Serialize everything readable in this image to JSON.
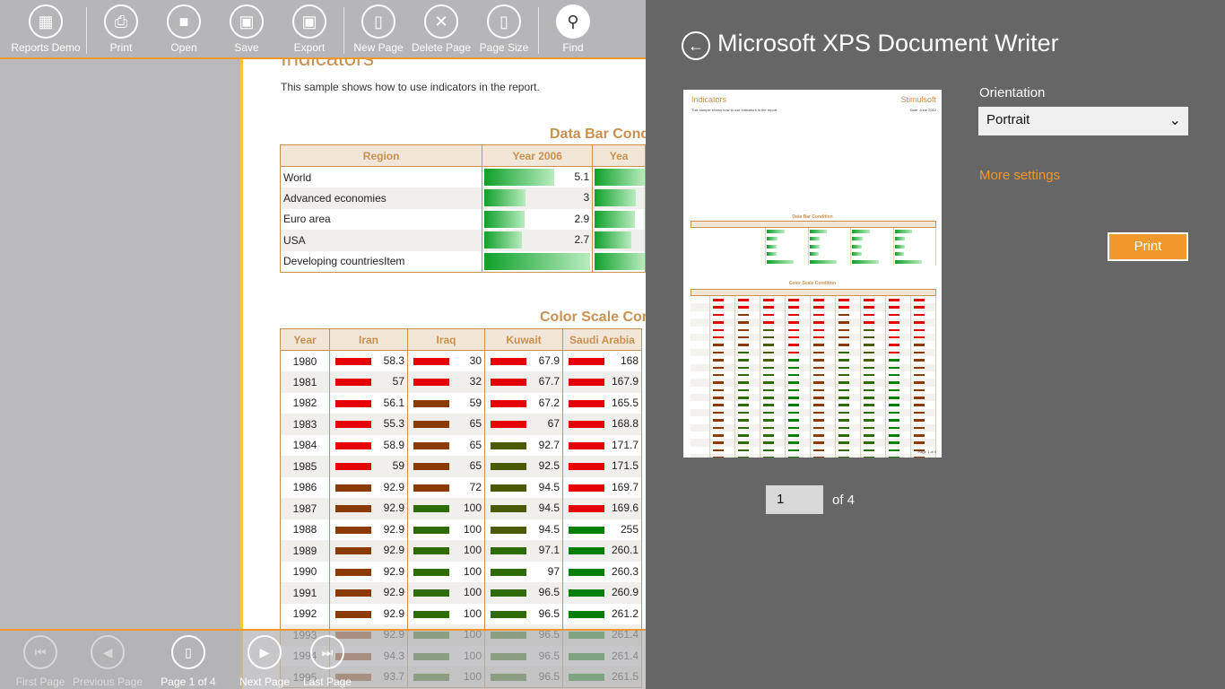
{
  "appbar": {
    "buttons": [
      {
        "label": "Reports Demo",
        "icon": "grid-icon"
      },
      {
        "label": "Print",
        "icon": "print-icon"
      },
      {
        "label": "Open",
        "icon": "folder-icon"
      },
      {
        "label": "Save",
        "icon": "save-icon"
      },
      {
        "label": "Export",
        "icon": "export-icon"
      },
      {
        "label": "New Page",
        "icon": "new-page-icon"
      },
      {
        "label": "Delete Page",
        "icon": "delete-page-icon"
      },
      {
        "label": "Page Size",
        "icon": "page-size-icon"
      },
      {
        "label": "Find",
        "icon": "search-icon"
      }
    ]
  },
  "report": {
    "title": "Indicators",
    "description": "This sample shows how to use indicators in the report.",
    "databar": {
      "title": "Data Bar Cond",
      "headers": [
        "Region",
        "Year 2006",
        "Yea"
      ],
      "rows": [
        {
          "region": "World",
          "value": "5.1",
          "fill": 0.66
        },
        {
          "region": "Advanced economies",
          "value": "3",
          "fill": 0.39
        },
        {
          "region": "Euro area",
          "value": "2.9",
          "fill": 0.38
        },
        {
          "region": "USA",
          "value": "2.7",
          "fill": 0.35
        },
        {
          "region": "Developing countriesItem",
          "value": "",
          "fill": 1.0
        }
      ]
    },
    "colorscale": {
      "title": "Color Scale Cor",
      "headers": [
        "Year",
        "Iran",
        "Iraq",
        "Kuwait",
        "Saudi Arabia"
      ],
      "rows": [
        {
          "year": "1980",
          "v": [
            "58.3",
            "30",
            "67.9",
            "168"
          ],
          "c": [
            "#e60000",
            "#e60000",
            "#e60000",
            "#e60000"
          ]
        },
        {
          "year": "1981",
          "v": [
            "57",
            "32",
            "67.7",
            "167.9"
          ],
          "c": [
            "#e60000",
            "#e60000",
            "#e60000",
            "#e60000"
          ]
        },
        {
          "year": "1982",
          "v": [
            "56.1",
            "59",
            "67.2",
            "165.5"
          ],
          "c": [
            "#e60000",
            "#8b3a00",
            "#e60000",
            "#e60000"
          ]
        },
        {
          "year": "1983",
          "v": [
            "55.3",
            "65",
            "67",
            "168.8"
          ],
          "c": [
            "#e60000",
            "#8b3a00",
            "#e60000",
            "#e60000"
          ]
        },
        {
          "year": "1984",
          "v": [
            "58.9",
            "65",
            "92.7",
            "171.7"
          ],
          "c": [
            "#e60000",
            "#8b3a00",
            "#4a5a00",
            "#e60000"
          ]
        },
        {
          "year": "1985",
          "v": [
            "59",
            "65",
            "92.5",
            "171.5"
          ],
          "c": [
            "#e60000",
            "#8b3a00",
            "#4a5a00",
            "#e60000"
          ]
        },
        {
          "year": "1986",
          "v": [
            "92.9",
            "72",
            "94.5",
            "169.7"
          ],
          "c": [
            "#8b3a00",
            "#8b3a00",
            "#4a5a00",
            "#e60000"
          ]
        },
        {
          "year": "1987",
          "v": [
            "92.9",
            "100",
            "94.5",
            "169.6"
          ],
          "c": [
            "#8b3a00",
            "#2e6b00",
            "#4a5a00",
            "#e60000"
          ]
        },
        {
          "year": "1988",
          "v": [
            "92.9",
            "100",
            "94.5",
            "255"
          ],
          "c": [
            "#8b3a00",
            "#2e6b00",
            "#4a5a00",
            "#008000"
          ]
        },
        {
          "year": "1989",
          "v": [
            "92.9",
            "100",
            "97.1",
            "260.1"
          ],
          "c": [
            "#8b3a00",
            "#2e6b00",
            "#2e6b00",
            "#008000"
          ]
        },
        {
          "year": "1990",
          "v": [
            "92.9",
            "100",
            "97",
            "260.3"
          ],
          "c": [
            "#8b3a00",
            "#2e6b00",
            "#2e6b00",
            "#008000"
          ]
        },
        {
          "year": "1991",
          "v": [
            "92.9",
            "100",
            "96.5",
            "260.9"
          ],
          "c": [
            "#8b3a00",
            "#2e6b00",
            "#2e6b00",
            "#008000"
          ]
        },
        {
          "year": "1992",
          "v": [
            "92.9",
            "100",
            "96.5",
            "261.2"
          ],
          "c": [
            "#8b3a00",
            "#2e6b00",
            "#2e6b00",
            "#008000"
          ]
        },
        {
          "year": "1993",
          "v": [
            "92.9",
            "100",
            "96.5",
            "261.4"
          ],
          "c": [
            "#8b3a00",
            "#2e6b00",
            "#2e6b00",
            "#008000"
          ]
        },
        {
          "year": "1994",
          "v": [
            "94.3",
            "100",
            "96.5",
            "261.4"
          ],
          "c": [
            "#8b3a00",
            "#2e6b00",
            "#2e6b00",
            "#008000"
          ]
        },
        {
          "year": "1995",
          "v": [
            "93.7",
            "100",
            "96.5",
            "261.5"
          ],
          "c": [
            "#8b3a00",
            "#2e6b00",
            "#2e6b00",
            "#008000"
          ]
        }
      ]
    }
  },
  "navbar": {
    "buttons": [
      {
        "label": "First Page",
        "icon": "first-page-icon",
        "enabled": false
      },
      {
        "label": "Previous Page",
        "icon": "previous-page-icon",
        "enabled": false
      },
      {
        "label": "Page 1 of 4",
        "icon": "page-icon",
        "enabled": true
      },
      {
        "label": "Next Page",
        "icon": "next-page-icon",
        "enabled": true
      },
      {
        "label": "Last Page",
        "icon": "last-page-icon",
        "enabled": true
      }
    ]
  },
  "flyout": {
    "title": "Microsoft XPS Document Writer",
    "orientation_label": "Orientation",
    "orientation_value": "Portrait",
    "more_settings": "More settings",
    "print_label": "Print",
    "page_value": "1",
    "page_of": "of 4",
    "preview": {
      "title": "Indicators",
      "brand": "Stimulsoft",
      "description": "This sample shows how to use indicators in the report.",
      "date": "Date: June 2012",
      "databar_title": "Data Bar Condition",
      "colorscale_title": "Color Scale Condition",
      "page_label": "Page 1 of 4"
    }
  },
  "colors": {
    "accent": "#f0982c",
    "report_header": "#c9904e",
    "flyout_bg": "#666666"
  }
}
